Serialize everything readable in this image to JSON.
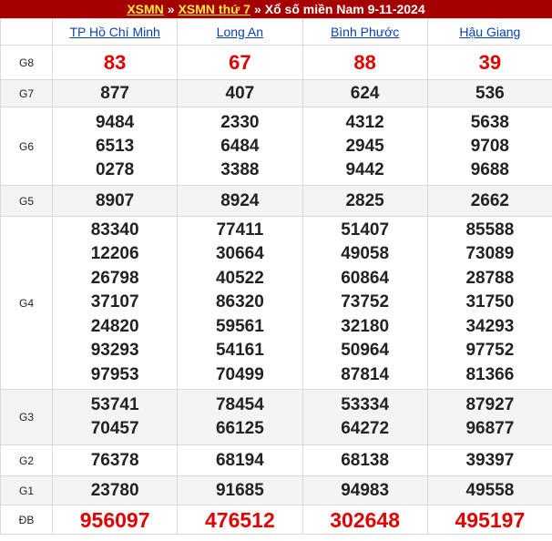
{
  "breadcrumb": {
    "link1": "XSMN",
    "sep1": "»",
    "link2": "XSMN thứ 7",
    "sep2": "»",
    "title": "Xổ số miền Nam 9-11-2024"
  },
  "provinces": [
    "TP Hồ Chí Minh",
    "Long An",
    "Bình Phước",
    "Hậu Giang"
  ],
  "prizes": [
    {
      "label": "G8",
      "values": [
        [
          "83"
        ],
        [
          "67"
        ],
        [
          "88"
        ],
        [
          "39"
        ]
      ]
    },
    {
      "label": "G7",
      "values": [
        [
          "877"
        ],
        [
          "407"
        ],
        [
          "624"
        ],
        [
          "536"
        ]
      ]
    },
    {
      "label": "G6",
      "values": [
        [
          "9484",
          "6513",
          "0278"
        ],
        [
          "2330",
          "6484",
          "3388"
        ],
        [
          "4312",
          "2945",
          "9442"
        ],
        [
          "5638",
          "9708",
          "9688"
        ]
      ]
    },
    {
      "label": "G5",
      "values": [
        [
          "8907"
        ],
        [
          "8924"
        ],
        [
          "2825"
        ],
        [
          "2662"
        ]
      ]
    },
    {
      "label": "G4",
      "values": [
        [
          "83340",
          "12206",
          "26798",
          "37107",
          "24820",
          "93293",
          "97953"
        ],
        [
          "77411",
          "30664",
          "40522",
          "86320",
          "59561",
          "54161",
          "70499"
        ],
        [
          "51407",
          "49058",
          "60864",
          "73752",
          "32180",
          "50964",
          "87814"
        ],
        [
          "85588",
          "73089",
          "28788",
          "31750",
          "34293",
          "97752",
          "81366"
        ]
      ]
    },
    {
      "label": "G3",
      "values": [
        [
          "53741",
          "70457"
        ],
        [
          "78454",
          "66125"
        ],
        [
          "53334",
          "64272"
        ],
        [
          "87927",
          "96877"
        ]
      ]
    },
    {
      "label": "G2",
      "values": [
        [
          "76378"
        ],
        [
          "68194"
        ],
        [
          "68138"
        ],
        [
          "39397"
        ]
      ]
    },
    {
      "label": "G1",
      "values": [
        [
          "23780"
        ],
        [
          "91685"
        ],
        [
          "94983"
        ],
        [
          "49558"
        ]
      ]
    },
    {
      "label": "ĐB",
      "values": [
        [
          "956097"
        ],
        [
          "476512"
        ],
        [
          "302648"
        ],
        [
          "495197"
        ]
      ]
    }
  ],
  "colors": {
    "header_bg": "#a40000",
    "link_yellow": "#ffeb3b",
    "special_red": "#e00000",
    "province_link": "#0b3fb0"
  }
}
